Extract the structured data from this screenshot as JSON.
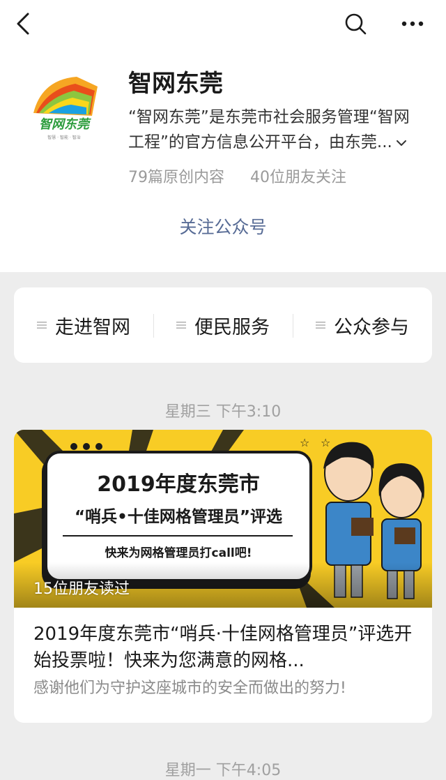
{
  "account": {
    "name": "智网东莞",
    "description": "“智网东莞”是东莞市社会服务管理“智网工程”的官方信息公开平台，由东莞...",
    "original_count": "79篇原创内容",
    "friends_follow": "40位朋友关注",
    "follow_label": "关注公众号",
    "logo_text": "智网东莞",
    "logo_subtext": "智慧 · 智能 · 智治"
  },
  "menu": {
    "items": [
      {
        "label": "走进智网"
      },
      {
        "label": "便民服务"
      },
      {
        "label": "公众参与"
      }
    ]
  },
  "feed": {
    "time1": "星期三 下午3:10",
    "time2": "星期一 下午4:05",
    "article": {
      "cover_line1": "2019年度东莞市",
      "cover_line2": "“哨兵•十佳网格管理员”评选",
      "cover_line3": "快来为网格管理员打call吧!",
      "read_count": "15位朋友读过",
      "title": "2019年度东莞市“哨兵·十佳网格管理员”评选开始投票啦！快来为您满意的网格...",
      "digest": "感谢他们为守护这座城市的安全而做出的努力!"
    }
  },
  "colors": {
    "link": "#576b95",
    "cover_yellow": "#f8cc25"
  }
}
